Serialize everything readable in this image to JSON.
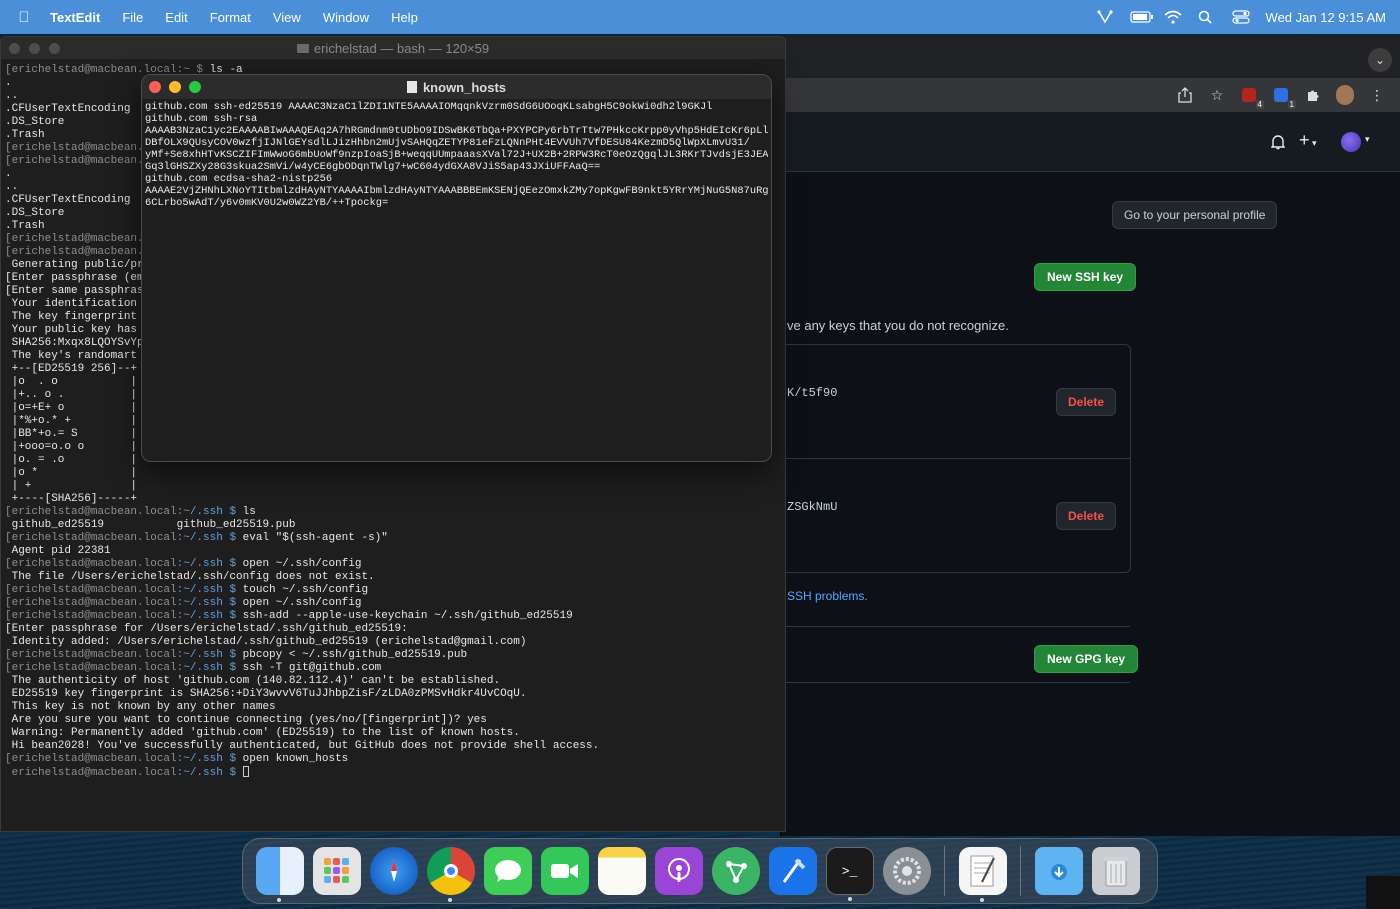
{
  "menubar": {
    "app_name": "TextEdit",
    "menus": [
      "File",
      "Edit",
      "Format",
      "View",
      "Window",
      "Help"
    ],
    "clock": "Wed Jan 12  9:15 AM"
  },
  "browser": {
    "go_profile_label": "Go to your personal profile",
    "new_ssh_label": "New SSH key",
    "notice_text": "ve any keys that you do not recognize.",
    "key1_fragment": "K/t5f90",
    "key2_fragment": "ZSGkNmU",
    "delete_label": "Delete",
    "ssh_problems_link": "SSH problems.",
    "new_gpg_label": "New GPG key",
    "extension_badges": [
      "4",
      "1"
    ]
  },
  "terminal": {
    "title": "erichelstad — bash — 120×59",
    "lines": [
      {
        "prompt": "[erichelstad@macbean.local:~ $ ",
        "cmd": "ls -a"
      },
      {
        "text": "."
      },
      {
        "text": ".."
      },
      {
        "text": ".CFUserTextEncoding"
      },
      {
        "text": ".DS_Store"
      },
      {
        "text": ".Trash"
      },
      {
        "prompt": "[erichelstad@macbean.l",
        "cmd": ""
      },
      {
        "prompt": "[erichelstad@macbean.l",
        "cmd": ""
      },
      {
        "text": "."
      },
      {
        "text": ".."
      },
      {
        "text": ".CFUserTextEncoding"
      },
      {
        "text": ".DS_Store"
      },
      {
        "text": ".Trash"
      },
      {
        "prompt": "[erichelstad@macbean.l",
        "cmd": ""
      },
      {
        "prompt": "[erichelstad@macbean.l",
        "cmd": ""
      },
      {
        "text": " Generating public/pri"
      },
      {
        "text": "[Enter passphrase (emp"
      },
      {
        "text": "[Enter same passphrase"
      },
      {
        "text": " Your identification h"
      },
      {
        "text": " The key fingerprint i"
      },
      {
        "text": " Your public key has b"
      },
      {
        "text": " SHA256:Mxqx8LQOYSvYpC"
      },
      {
        "text": " The key's randomart i"
      },
      {
        "text": " +--[ED25519 256]--+"
      },
      {
        "text": " |o  . o           |"
      },
      {
        "text": " |+.. o .          |"
      },
      {
        "text": " |o=+E+ o          |"
      },
      {
        "text": " |*%+o.* +         |"
      },
      {
        "text": " |BB*+o.= S        |"
      },
      {
        "text": " |+ooo=o.o o       |"
      },
      {
        "text": " |o. = .o          |"
      },
      {
        "text": " |o *              |"
      },
      {
        "text": " | +               |"
      },
      {
        "text": " +----[SHA256]-----+"
      },
      {
        "prompt": "[erichelstad@macbean.local:",
        "path": "~/.ssh $ ",
        "cmd": "ls"
      },
      {
        "text": " github_ed25519           github_ed25519.pub"
      },
      {
        "prompt": "[erichelstad@macbean.local:",
        "path": "~/.ssh $ ",
        "cmd": "eval \"$(ssh-agent -s)\""
      },
      {
        "text": " Agent pid 22381"
      },
      {
        "prompt": "[erichelstad@macbean.local:",
        "path": "~/.ssh $ ",
        "cmd": "open ~/.ssh/config"
      },
      {
        "text": " The file /Users/erichelstad/.ssh/config does not exist."
      },
      {
        "prompt": "[erichelstad@macbean.local:",
        "path": "~/.ssh $ ",
        "cmd": "touch ~/.ssh/config"
      },
      {
        "prompt": "[erichelstad@macbean.local:",
        "path": "~/.ssh $ ",
        "cmd": "open ~/.ssh/config"
      },
      {
        "prompt": "[erichelstad@macbean.local:",
        "path": "~/.ssh $ ",
        "cmd": "ssh-add --apple-use-keychain ~/.ssh/github_ed25519"
      },
      {
        "text": "[Enter passphrase for /Users/erichelstad/.ssh/github_ed25519:"
      },
      {
        "text": " Identity added: /Users/erichelstad/.ssh/github_ed25519 (erichelstad@gmail.com)"
      },
      {
        "prompt": "[erichelstad@macbean.local:",
        "path": "~/.ssh $ ",
        "cmd": "pbcopy < ~/.ssh/github_ed25519.pub"
      },
      {
        "prompt": "[erichelstad@macbean.local:",
        "path": "~/.ssh $ ",
        "cmd": "ssh -T git@github.com"
      },
      {
        "text": " The authenticity of host 'github.com (140.82.112.4)' can't be established."
      },
      {
        "text": " ED25519 key fingerprint is SHA256:+DiY3wvvV6TuJJhbpZisF/zLDA0zPMSvHdkr4UvCOqU."
      },
      {
        "text": " This key is not known by any other names"
      },
      {
        "text": " Are you sure you want to continue connecting (yes/no/[fingerprint])? yes"
      },
      {
        "text": " Warning: Permanently added 'github.com' (ED25519) to the list of known hosts."
      },
      {
        "text": " Hi bean2028! You've successfully authenticated, but GitHub does not provide shell access."
      },
      {
        "prompt": "[erichelstad@macbean.local:",
        "path": "~/.ssh $ ",
        "cmd": "open known_hosts"
      },
      {
        "prompt": " erichelstad@macbean.local:",
        "path": "~/.ssh $ ",
        "cmd": "",
        "cursor": true
      }
    ]
  },
  "textedit": {
    "title": "known_hosts",
    "lines": [
      "github.com ssh-ed25519 AAAAC3NzaC1lZDI1NTE5AAAAIOMqqnkVzrm0SdG6UOoqKLsabgH5C9okWi0dh2l9GKJl",
      "github.com ssh-rsa",
      "AAAAB3NzaC1yc2EAAAABIwAAAQEAq2A7hRGmdnm9tUDbO9IDSwBK6TbQa+PXYPCPy6rbTrTtw7PHkccKrpp0yVhp5HdEIcKr6pLlV",
      "DBfOLX9QUsyCOV0wzfjIJNlGEYsdlLJizHhbn2mUjvSAHQqZETYP81eFzLQNnPHt4EVVUh7VfDESU84KezmD5QlWpXLmvU31/",
      "yMf+Se8xhHTvKSCZIFImWwoG6mbUoWf9nzpIoaSjB+weqqUUmpaaasXVal72J+UX2B+2RPW3RcT0eOzQgqlJL3RKrTJvdsjE3JEAv",
      "Gq3lGHSZXy28G3skua2SmVi/w4yCE6gbODqnTWlg7+wC604ydGXA8VJiS5ap43JXiUFFAaQ==",
      "github.com ecdsa-sha2-nistp256",
      "AAAAE2VjZHNhLXNoYTItbmlzdHAyNTYAAAAIbmlzdHAyNTYAAABBBEmKSENjQEezOmxkZMy7opKgwFB9nkt5YRrYMjNuG5N87uRgg",
      "6CLrbo5wAdT/y6v0mKV0U2w0WZ2YB/++Tpockg="
    ]
  },
  "dock": {
    "items": [
      "Finder",
      "Launchpad",
      "Safari",
      "Google Chrome",
      "Messages",
      "FaceTime",
      "Notes",
      "Podcasts",
      "Sourcetree",
      "Xcode",
      "Terminal",
      "System Preferences",
      "TextEdit",
      "Downloads",
      "Trash"
    ],
    "terminal_glyph": ">_"
  },
  "colors": {
    "menubar": "#4a8fd8",
    "github_green": "#238636",
    "github_danger": "#f85149",
    "prompt_path": "#62a0d8"
  }
}
